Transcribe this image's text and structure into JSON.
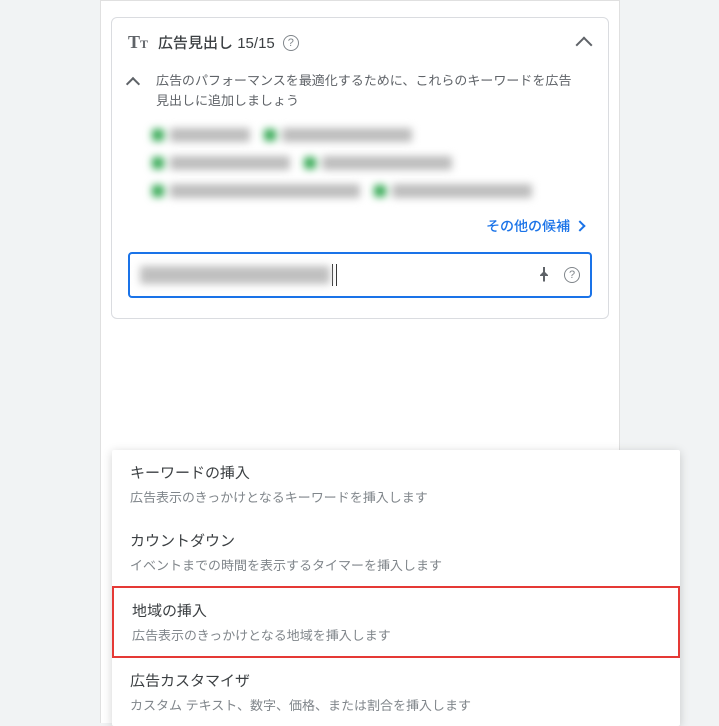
{
  "header": {
    "title": "広告見出し",
    "count": "15/15"
  },
  "sub": {
    "text": "広告のパフォーマンスを最適化するために、これらのキーワードを広告見出しに追加しましょう"
  },
  "more": {
    "label": "その他の候補"
  },
  "dropdown": [
    {
      "title": "キーワードの挿入",
      "desc": "広告表示のきっかけとなるキーワードを挿入します"
    },
    {
      "title": "カウントダウン",
      "desc": "イベントまでの時間を表示するタイマーを挿入します"
    },
    {
      "title": "地域の挿入",
      "desc": "広告表示のきっかけとなる地域を挿入します"
    },
    {
      "title": "広告カスタマイザ",
      "desc": "カスタム テキスト、数字、価格、または割合を挿入します"
    }
  ]
}
